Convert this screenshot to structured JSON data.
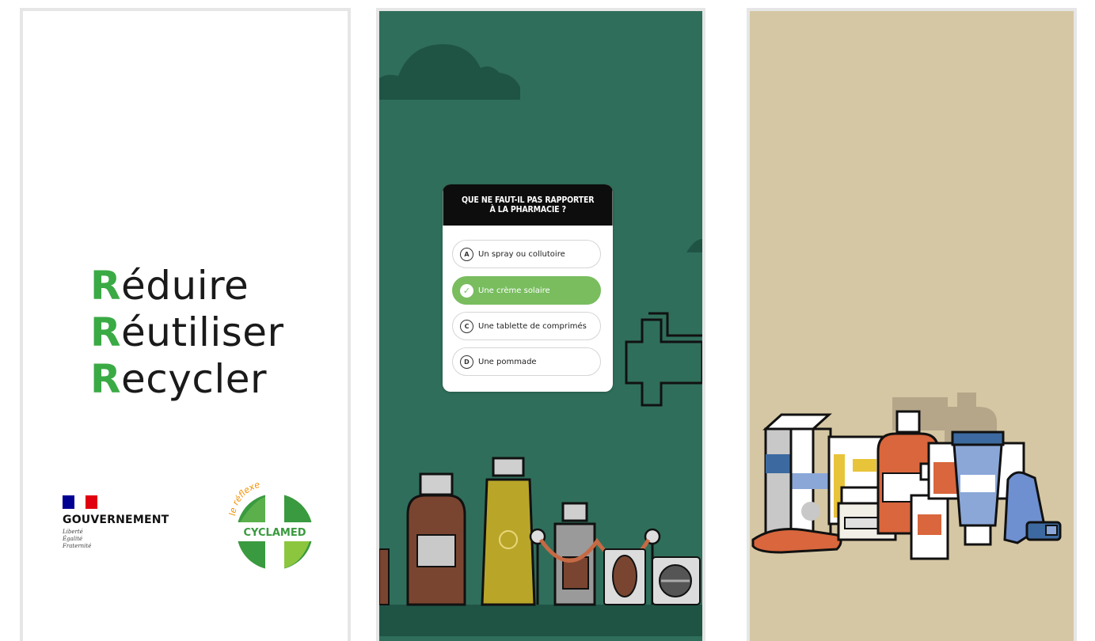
{
  "panel1": {
    "lines": [
      {
        "initial": "R",
        "rest": "éduire"
      },
      {
        "initial": "R",
        "rest": "éutiliser"
      },
      {
        "initial": "R",
        "rest": "ecycler"
      }
    ],
    "government": {
      "name": "GOUVERNEMENT",
      "motto": [
        "Liberté",
        "Égalité",
        "Fraternité"
      ],
      "flag_colors": [
        "#000091",
        "#ffffff",
        "#e1000f"
      ]
    },
    "cyclamed": {
      "tagline": "le réflexe",
      "name": "CYCLAMED",
      "colors": {
        "green": "#3a9a3f",
        "light": "#8cc63f",
        "orange": "#f29100"
      }
    }
  },
  "panel2": {
    "question": {
      "line1": "QUE NE FAUT-IL PAS RAPPORTER",
      "line2": "À LA PHARMACIE ?"
    },
    "options": [
      {
        "letter": "A",
        "text": "Un spray ou collutoire",
        "correct": false
      },
      {
        "letter": "",
        "text": "Une crème solaire",
        "correct": true
      },
      {
        "letter": "C",
        "text": "Une tablette de comprimés",
        "correct": false
      },
      {
        "letter": "D",
        "text": "Une pommade",
        "correct": false
      }
    ],
    "colors": {
      "background": "#2f6e5b",
      "correct": "#79bd5f",
      "cloud": "#1f5445"
    }
  },
  "panel3": {
    "colors": {
      "background": "#d6c7a4"
    }
  }
}
